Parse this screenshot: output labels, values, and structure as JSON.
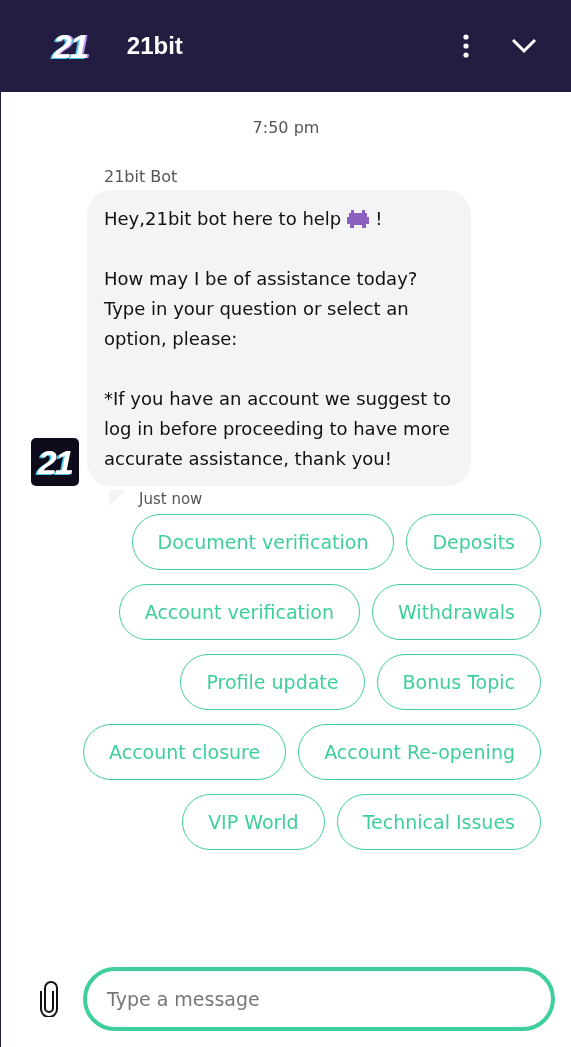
{
  "header": {
    "logo": "21",
    "title": "21bit"
  },
  "chat": {
    "timestamp": "7:50 pm",
    "sender": "21bit Bot",
    "avatar": "21",
    "message": {
      "greeting": "Hey,21bit bot here to help",
      "greeting_end": "!",
      "paragraphs": [
        "How may I be of assistance today? Type in your question or select an option, please:",
        "*If you have an account we suggest to log in before proceeding to have more accurate assistance, thank you!"
      ]
    },
    "sent": "Just now"
  },
  "quick_replies": [
    [
      "Document verification",
      "Deposits"
    ],
    [
      "Account verification",
      "Withdrawals"
    ],
    [
      "Profile update",
      "Bonus Topic"
    ],
    [
      "Account closure",
      "Account Re-opening"
    ],
    [
      "VIP World",
      "Technical Issues"
    ]
  ],
  "composer": {
    "placeholder": "Type a message"
  }
}
